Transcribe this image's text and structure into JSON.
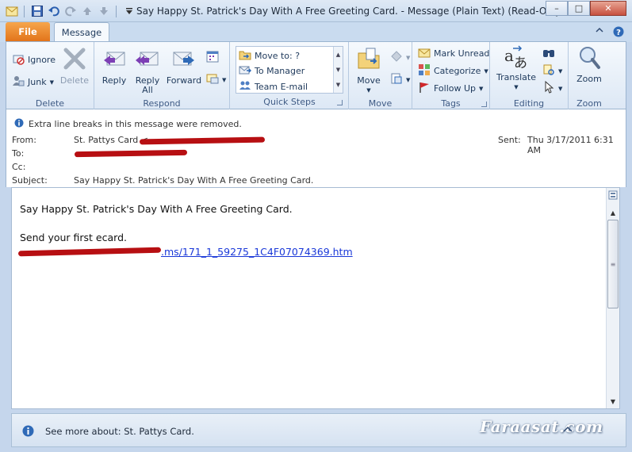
{
  "window": {
    "title": "Say Happy St. Patrick's Day With A Free Greeting Card.  -  Message (Plain Text) (Read-Only)"
  },
  "tabs": {
    "file": "File",
    "message": "Message"
  },
  "ribbon": {
    "delete_group": {
      "label": "Delete",
      "ignore": "Ignore",
      "junk": "Junk",
      "delete": "Delete"
    },
    "respond_group": {
      "label": "Respond",
      "reply": "Reply",
      "reply_all_line1": "Reply",
      "reply_all_line2": "All",
      "forward": "Forward"
    },
    "quick_steps": {
      "label": "Quick Steps",
      "items": [
        "Move to: ?",
        "To Manager",
        "Team E-mail"
      ]
    },
    "move_group": {
      "label": "Move",
      "move": "Move"
    },
    "tags_group": {
      "label": "Tags",
      "mark_unread": "Mark Unread",
      "categorize": "Categorize",
      "follow_up": "Follow Up"
    },
    "editing_group": {
      "label": "Editing",
      "translate": "Translate"
    },
    "zoom_group": {
      "label": "Zoom",
      "zoom": "Zoom"
    }
  },
  "header": {
    "info": "Extra line breaks in this message were removed.",
    "from_label": "From:",
    "from_value": "St. Pattys Card <",
    "to_label": "To:",
    "cc_label": "Cc:",
    "subject_label": "Subject:",
    "subject_value": "Say Happy St. Patrick's Day With A Free Greeting Card.",
    "sent_label": "Sent:",
    "sent_value": "Thu 3/17/2011 6:31 AM"
  },
  "body": {
    "line1": "Say Happy St. Patrick's Day With A Free Greeting Card.",
    "line2": "Send your first ecard.",
    "link_suffix": ".ms/171_1_59275_1C4F07074369.htm"
  },
  "people_pane": {
    "text": "See more about: St. Pattys Card."
  },
  "watermark": "Faraasat.com",
  "colors": {
    "file_tab": "#e2741b",
    "redaction": "#b70f12",
    "link": "#1a38d8",
    "info_icon": "#2f6ab7"
  }
}
